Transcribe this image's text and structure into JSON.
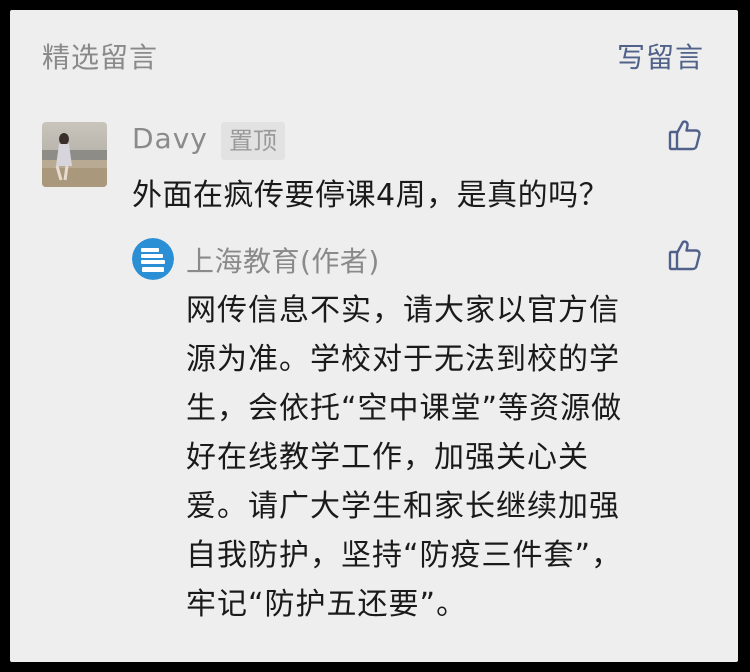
{
  "header": {
    "title": "精选留言",
    "write_label": "写留言"
  },
  "comment": {
    "username": "Davy",
    "pin_label": "置顶",
    "text": "外面在疯传要停课4周，是真的吗？",
    "like_icon": "thumbs-up-icon"
  },
  "reply": {
    "author": "上海教育(作者)",
    "avatar_text": "上海教育",
    "like_icon": "thumbs-up-icon",
    "lines": [
      "网传信息不实，请大家以官方信",
      "源为准。学校对于无法到校的学",
      "生，会依托“空中课堂”等资源做",
      "好在线教学工作，加强关心关",
      "爱。请广大学生和家长继续加强",
      "自我防护，坚持“防疫三件套”，",
      "牢记“防护五还要”。"
    ]
  },
  "colors": {
    "background": "#eeeeee",
    "accent_link": "#50628a",
    "muted_text": "#8a8a8a",
    "body_text": "#1a1a1a",
    "icon_stroke": "#50628a"
  }
}
